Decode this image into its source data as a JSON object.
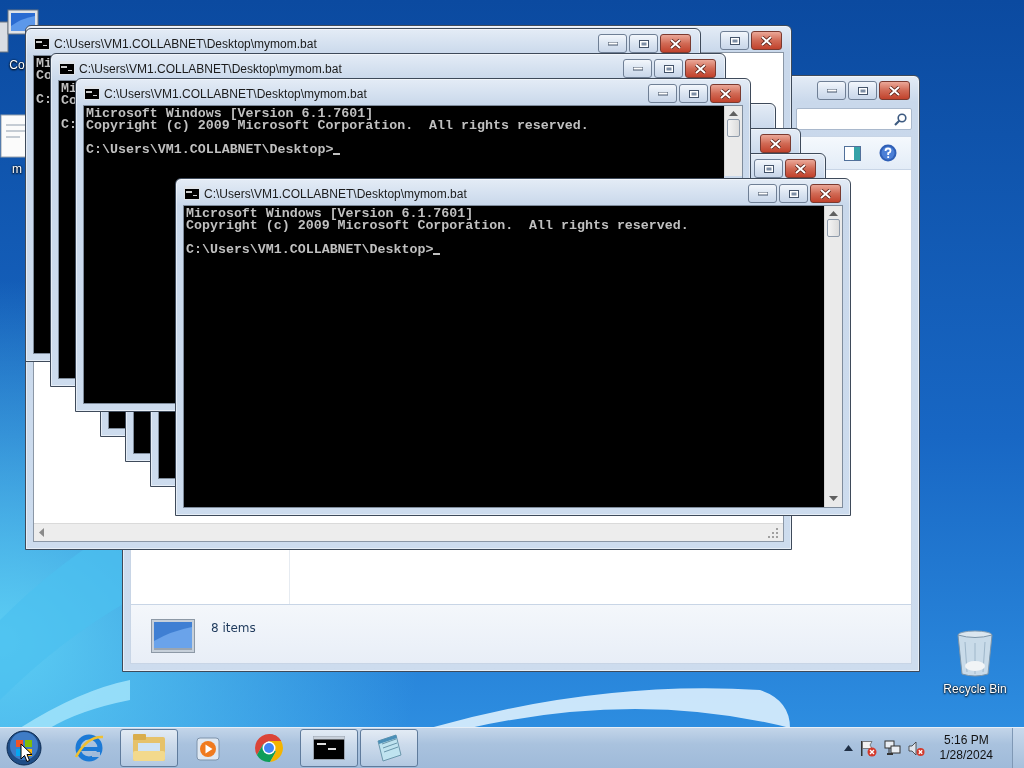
{
  "desktop_icons": [
    {
      "kind": "computer",
      "label": "Co"
    },
    {
      "kind": "document",
      "label": "m"
    },
    {
      "kind": "recycle_bin",
      "label": "Recycle Bin"
    }
  ],
  "explorer": {
    "status_bar": "8 items"
  },
  "consoles": [
    {
      "kind": "console"
    },
    {
      "kind": "console"
    },
    {
      "kind": "console"
    },
    {
      "kind": "console",
      "title": "C:\\Users\\VM1.COLLABNET\\Desktop\\mymom.bat",
      "banner": [
        "Mi",
        "Co"
      ],
      "prompt": "C:"
    },
    {
      "kind": "console",
      "title": "C:\\Users\\VM1.COLLABNET\\Desktop\\mymom.bat",
      "banner": [
        "Mi",
        "Co"
      ],
      "prompt": "C:"
    },
    {
      "kind": "console",
      "title": "C:\\Users\\VM1.COLLABNET\\Desktop\\mymom.bat",
      "banner": [
        "Microsoft Windows [Version 6.1.7601]",
        "Copyright (c) 2009 Microsoft Corporation.  All rights reserved."
      ],
      "prompt": "C:\\Users\\VM1.COLLABNET\\Desktop>",
      "cursor": true
    },
    {
      "kind": "console",
      "title": "C:\\Users\\VM1.COLLABNET\\Desktop\\mymom.bat",
      "banner": [
        "Microsoft Windows [Version 6.1.7601]",
        "Copyright (c) 2009 Microsoft Corporation.  All rights reserved."
      ],
      "prompt": "C:\\Users\\VM1.COLLABNET\\Desktop>",
      "cursor": true
    }
  ],
  "taskbar": {
    "apps": [
      {
        "kind": "ie",
        "running": false
      },
      {
        "kind": "explorer",
        "running": true
      },
      {
        "kind": "media_player",
        "running": false
      },
      {
        "kind": "chrome",
        "running": false
      },
      {
        "kind": "console",
        "running": true
      },
      {
        "kind": "notepad",
        "running": true
      }
    ],
    "tray": [
      {
        "kind": "show_hidden"
      },
      {
        "kind": "action_center"
      },
      {
        "kind": "network"
      },
      {
        "kind": "volume_muted"
      }
    ],
    "clock": {
      "time": "5:16 PM",
      "date": "1/28/2024"
    }
  }
}
